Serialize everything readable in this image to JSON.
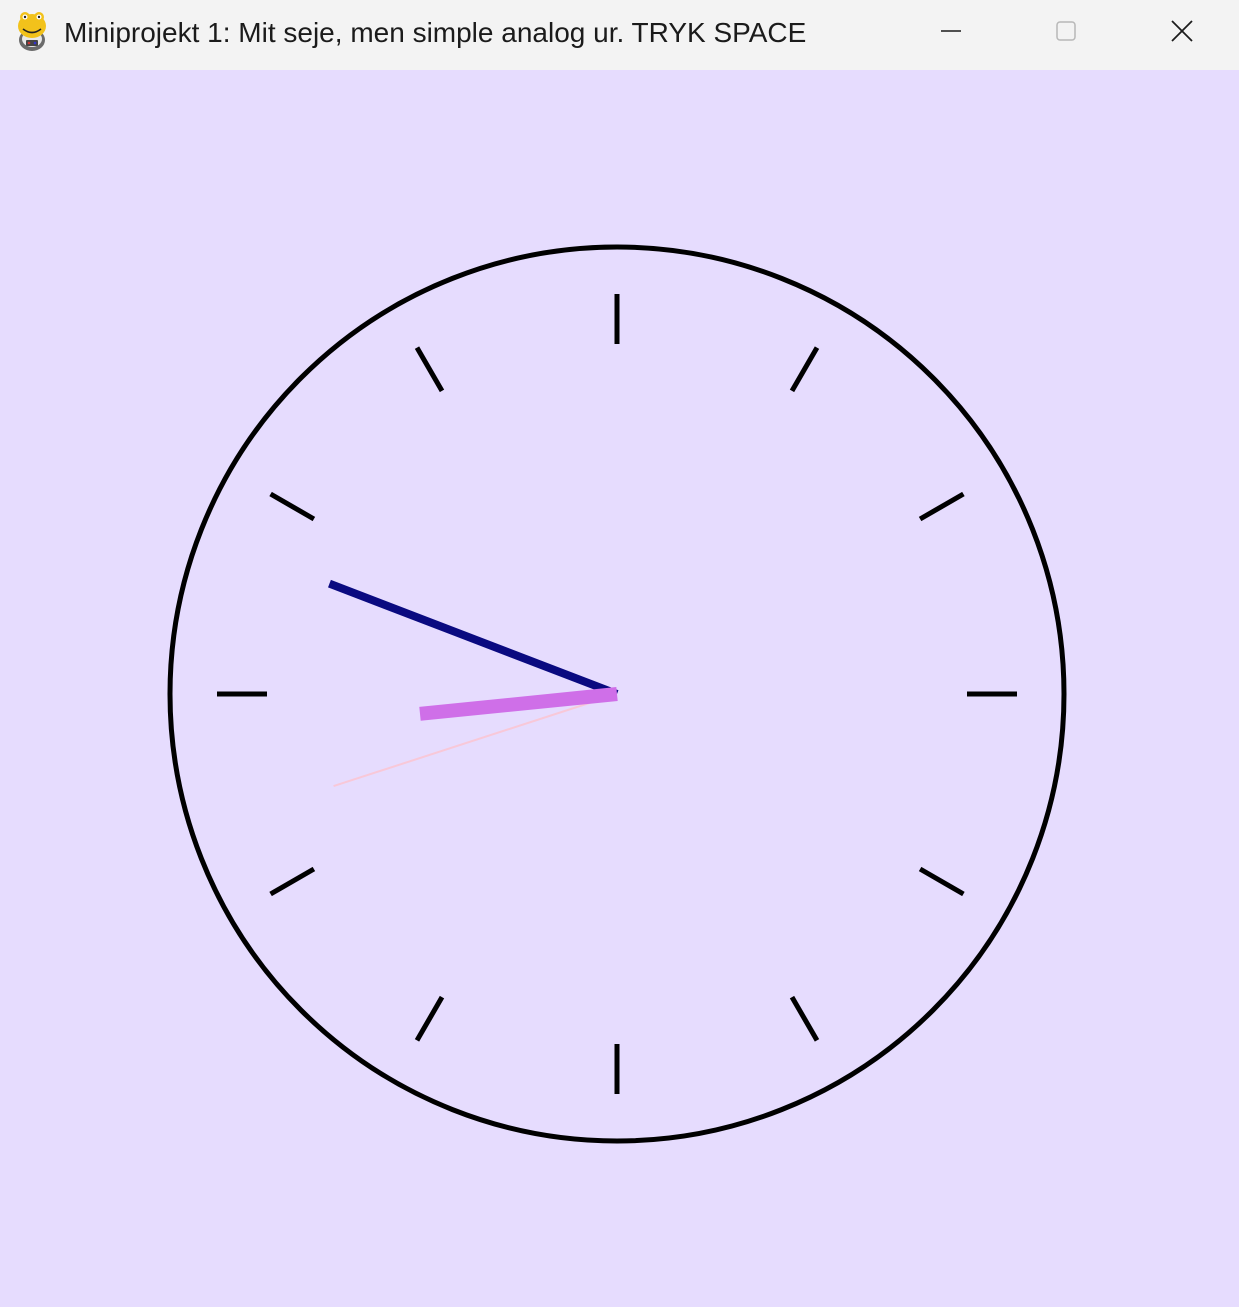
{
  "window": {
    "title": "Miniprojekt 1: Mit seje, men simple analog ur. TRYK SPACE",
    "app_icon": "pygame-snake-icon",
    "controls": {
      "minimize_icon": "minimize-icon",
      "maximize_icon": "maximize-icon",
      "close_icon": "close-icon"
    }
  },
  "clock": {
    "background_color": "#e6dcfe",
    "face_color": "#000000",
    "hour_hand_color": "#cf6fe8",
    "minute_hand_color": "#0a0a80",
    "second_hand_color": "#f8c8d8",
    "time_shown": {
      "hours": 8,
      "minutes": 48.5,
      "seconds": 42
    },
    "tick_count": 12
  }
}
